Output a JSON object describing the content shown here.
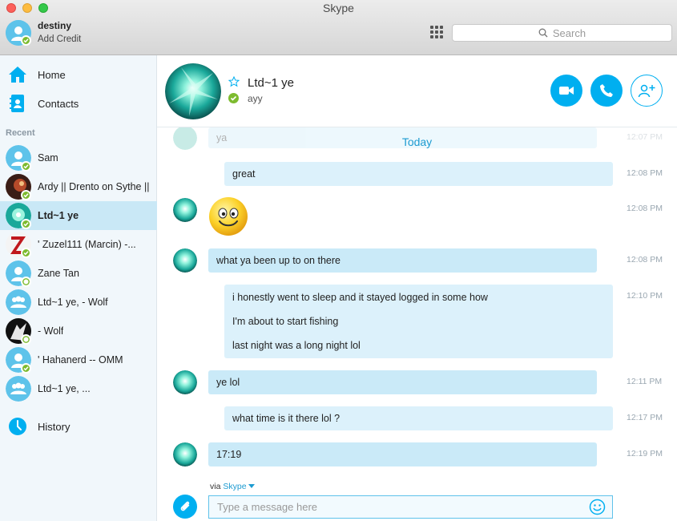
{
  "window": {
    "title": "Skype"
  },
  "profile": {
    "name": "destiny",
    "credit_label": "Add Credit"
  },
  "search": {
    "placeholder": "Search"
  },
  "nav": {
    "home": "Home",
    "contacts": "Contacts",
    "history": "History"
  },
  "sidebar": {
    "recent_label": "Recent",
    "contacts": [
      {
        "name": "Sam",
        "avatar": "default",
        "presence": "online"
      },
      {
        "name": "Ardy || Drento on Sythe ||",
        "avatar": "photo-dark",
        "presence": "online"
      },
      {
        "name": "Ltd~1 ye",
        "avatar": "crystal",
        "presence": "online",
        "active": true
      },
      {
        "name": "' Zuzel111 (Marcin) -...",
        "avatar": "red-z",
        "presence": "online"
      },
      {
        "name": "Zane Tan",
        "avatar": "default",
        "presence": "offline"
      },
      {
        "name": "Ltd~1 ye, - Wolf",
        "avatar": "group",
        "presence": "none"
      },
      {
        "name": "- Wolf",
        "avatar": "wolf",
        "presence": "offline"
      },
      {
        "name": "' Hahanerd -- OMM",
        "avatar": "default",
        "presence": "online"
      },
      {
        "name": "Ltd~1 ye, ...",
        "avatar": "group",
        "presence": "none"
      }
    ]
  },
  "conversation": {
    "name": "Ltd~1 ye",
    "mood": "ayy",
    "today_label": "Today",
    "faded_text": "ya",
    "faded_time": "12:07 PM",
    "messages": [
      {
        "dir": "out",
        "lines": [
          "great"
        ],
        "time": "12:08 PM"
      },
      {
        "dir": "in",
        "emoticon": "smile",
        "time": "12:08 PM"
      },
      {
        "dir": "in",
        "lines": [
          "what ya been up to on there"
        ],
        "time": "12:08 PM"
      },
      {
        "dir": "out",
        "lines": [
          "i honestly went to sleep and it stayed logged in some how",
          "I'm about to start fishing",
          "last night was a long night lol"
        ],
        "time": "12:10 PM"
      },
      {
        "dir": "in",
        "lines": [
          "ye lol"
        ],
        "time": "12:11 PM"
      },
      {
        "dir": "out",
        "lines": [
          "what time is it there lol ?"
        ],
        "time": "12:17 PM"
      },
      {
        "dir": "in",
        "lines": [
          "17:19"
        ],
        "time": "12:19 PM"
      }
    ]
  },
  "compose": {
    "via_prefix": "via",
    "via_link": "Skype",
    "placeholder": "Type a message here"
  },
  "colors": {
    "accent": "#00aff0",
    "online": "#7dbb2f",
    "bubble_in": "#caeaf8",
    "bubble_out": "#dcf1fb"
  }
}
